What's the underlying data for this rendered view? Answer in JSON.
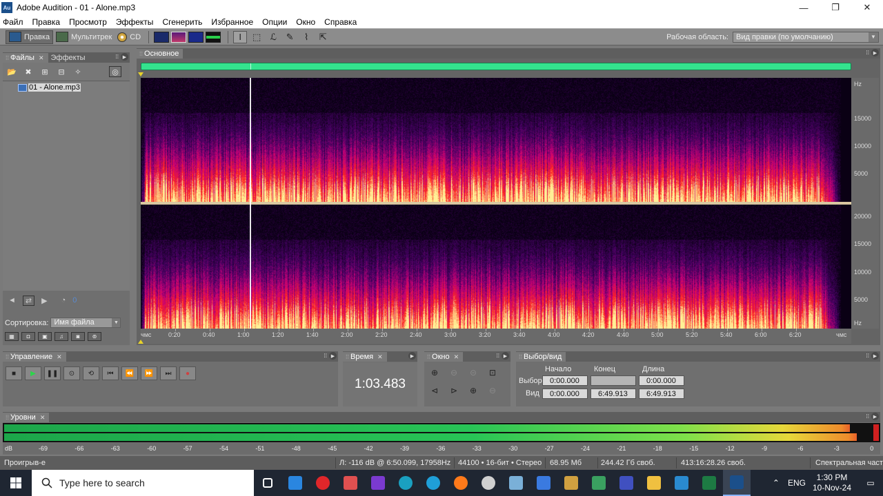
{
  "window": {
    "app_icon": "Au",
    "title": "Adobe Audition - 01 - Alone.mp3",
    "controls": [
      "—",
      "❐",
      "✕"
    ]
  },
  "menu": [
    "Файл",
    "Правка",
    "Просмотр",
    "Эффекты",
    "Сгенерить",
    "Избранное",
    "Опции",
    "Окно",
    "Справка"
  ],
  "toolbar": {
    "edit_label": "Правка",
    "multitrack_label": "Мультитрек",
    "cd_label": "CD",
    "workspace_label": "Рабочая область:",
    "workspace_value": "Вид правки (по умолчанию)"
  },
  "files_panel": {
    "tab_files": "Файлы",
    "tab_effects": "Эффекты",
    "file_name": "01 - Alone.mp3",
    "sort_label": "Сортировка:",
    "sort_value": "Имя файла",
    "volume_value": "0"
  },
  "main_panel": {
    "tab": "Основное",
    "hz_unit": "Hz",
    "hz_ticks_ch1": [
      "15000",
      "10000",
      "5000"
    ],
    "hz_ticks_ch2": [
      "20000",
      "15000",
      "10000",
      "5000",
      "Hz"
    ],
    "time_start": "чмс",
    "time_end": "чмс",
    "time_ticks": [
      "0:20",
      "0:40",
      "1:00",
      "1:20",
      "1:40",
      "2:00",
      "2:20",
      "2:40",
      "3:00",
      "3:20",
      "3:40",
      "4:00",
      "4:20",
      "4:40",
      "5:00",
      "5:20",
      "5:40",
      "6:00",
      "6:20"
    ]
  },
  "transport": {
    "tab": "Управление"
  },
  "time": {
    "tab": "Время",
    "value": "1:03.483"
  },
  "zoom": {
    "tab": "Окно"
  },
  "selection": {
    "tab": "Выбор/вид",
    "col_start": "Начало",
    "col_end": "Конец",
    "col_length": "Длина",
    "row_selection": "Выбор",
    "row_view": "Вид",
    "sel_start": "0:00.000",
    "sel_end": "",
    "sel_length": "0:00.000",
    "view_start": "0:00.000",
    "view_end": "6:49.913",
    "view_length": "6:49.913"
  },
  "levels": {
    "tab": "Уровни",
    "scale": [
      "dB",
      "-69",
      "-66",
      "-63",
      "-60",
      "-57",
      "-54",
      "-51",
      "-48",
      "-45",
      "-42",
      "-39",
      "-36",
      "-33",
      "-30",
      "-27",
      "-24",
      "-21",
      "-18",
      "-15",
      "-12",
      "-9",
      "-6",
      "-3",
      "0"
    ]
  },
  "status": {
    "state": "Проигрыв-е",
    "cursor_info": "Л: -116 dB @  6:50.099, 17958Hz",
    "format": "44100 • 16-бит • Стерео",
    "file_size": "68.95 Мб",
    "disk_free": "244.42 Гб своб.",
    "time_free": "413:16:28.26 своб.",
    "view_mode": "Спектральная часто"
  },
  "taskbar": {
    "search_placeholder": "Type here to search",
    "lang": "ENG",
    "time": "1:30 PM",
    "date": "10-Nov-24"
  }
}
